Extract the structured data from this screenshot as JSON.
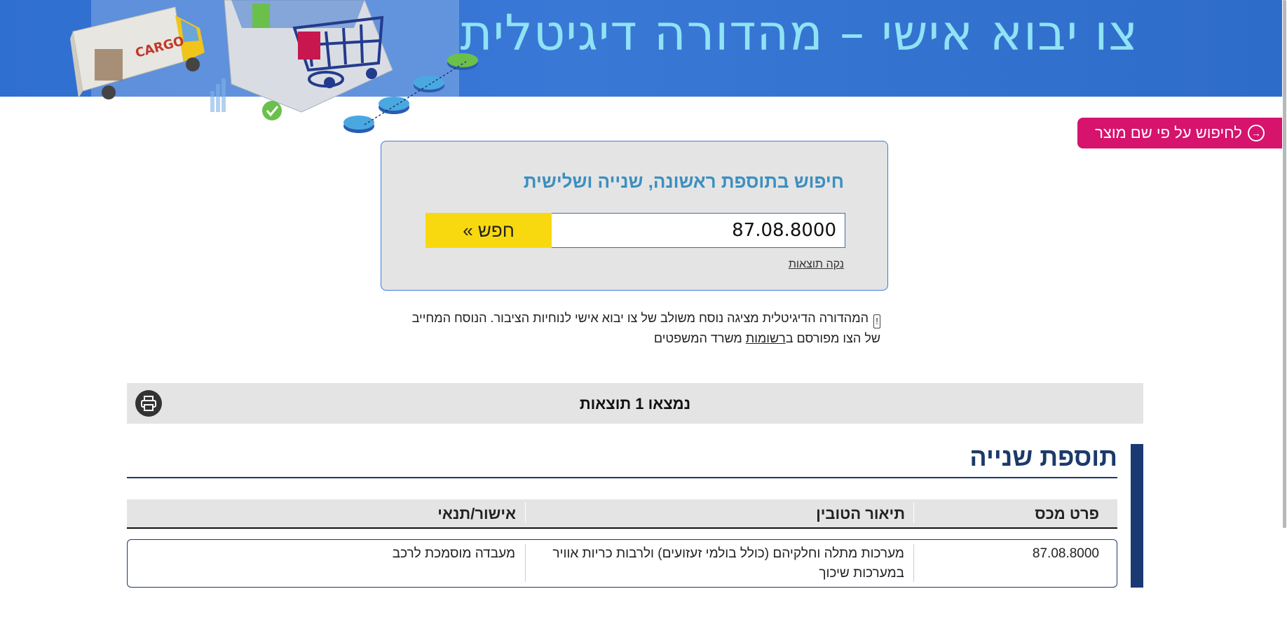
{
  "banner": {
    "title": "צו יבוא אישי – מהדורה דיגיטלית",
    "truck_text": "CARGO"
  },
  "name_search_button": {
    "label": "לחיפוש על פי שם מוצר",
    "icon": "arrow-circle-icon"
  },
  "search": {
    "heading": "חיפוש בתוספת ראשונה, שנייה ושלישית",
    "input_value": "87.08.8000",
    "button_label": "חפש »",
    "clear_label": "נקה תוצאות"
  },
  "notice": {
    "warning_glyph": "!",
    "text_before_link": "המהדורה הדיגיטלית מציגה נוסח משולב של צו יבוא אישי לנוחיות הציבור. הנוסח המחייב של הצו מפורסם ב",
    "link_text": "רשומות",
    "text_after_link": " משרד המשפטים"
  },
  "results": {
    "count_text": "נמצאו 1 תוצאות",
    "print_icon": "printer-icon"
  },
  "section": {
    "title": "תוספת שנייה",
    "accent_color": "#1b3a73",
    "columns": [
      "פרט מכס",
      "תיאור הטובין",
      "אישור/תנאי"
    ],
    "rows": [
      {
        "code": "87.08.8000",
        "description": "מערכות מתלה וחלקיהם (כולל בולמי זעזועים) ולרבות כריות אוויר במערכות שיכוך",
        "condition": "מעבדה מוסמכת לרכב"
      }
    ]
  },
  "colors": {
    "banner_blue": "#2f6fd0",
    "banner_title": "#8fe3f5",
    "pink_button": "#d6136d",
    "search_button": "#f8d90f",
    "heading_blue": "#3c8fc0",
    "navy": "#1b3a6b"
  }
}
